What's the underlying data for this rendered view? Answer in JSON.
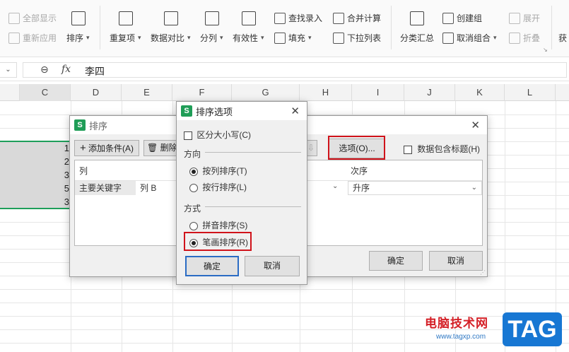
{
  "ribbon": {
    "show_all": "全部显示",
    "reapply": "重新应用",
    "sort": "排序",
    "duplicates": "重复项",
    "compare": "数据对比",
    "split": "分列",
    "validity": "有效性",
    "find_entry": "查找录入",
    "fill": "填充",
    "consolidate": "合并计算",
    "dropdown_list": "下拉列表",
    "subtotal": "分类汇总",
    "create_group": "创建组",
    "ungroup": "取消组合",
    "expand": "展开",
    "collapse": "折叠",
    "get": "获"
  },
  "formula_bar": {
    "fx": "fx",
    "value": "李四"
  },
  "columns": [
    "C",
    "D",
    "E",
    "F",
    "G",
    "H",
    "I",
    "J",
    "K",
    "L"
  ],
  "cells_col_c": [
    "1",
    "2",
    "3",
    "5",
    "3"
  ],
  "sort_dialog": {
    "title": "排序",
    "add_condition": "添加条件(A)",
    "delete": "删除",
    "options": "选项(O)...",
    "header_checkbox": "数据包含标题(H)",
    "col_header": "列",
    "order_header": "次序",
    "main_key": "主要关键字",
    "column_value": "列 B",
    "order_value": "升序",
    "ok": "确定",
    "cancel": "取消"
  },
  "options_dialog": {
    "title": "排序选项",
    "case_sensitive": "区分大小写(C)",
    "direction_label": "方向",
    "by_column": "按列排序(T)",
    "by_row": "按行排序(L)",
    "method_label": "方式",
    "pinyin": "拼音排序(S)",
    "stroke": "笔画排序(R)",
    "ok": "确定",
    "cancel": "取消"
  },
  "watermark": {
    "site_name": "电脑技术网",
    "url": "www.tagxp.com",
    "logo": "TAG"
  }
}
